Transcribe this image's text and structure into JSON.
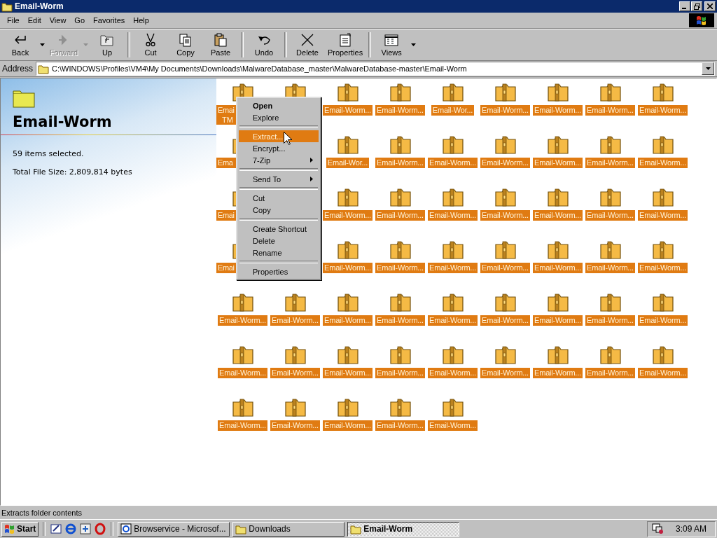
{
  "window": {
    "title": "Email-Worm"
  },
  "menu_bar": [
    "File",
    "Edit",
    "View",
    "Go",
    "Favorites",
    "Help"
  ],
  "toolbar": [
    {
      "label": "Back",
      "kind": "back",
      "disabled": false,
      "dropdown": true
    },
    {
      "label": "Forward",
      "kind": "forward",
      "disabled": true,
      "dropdown": true
    },
    {
      "label": "Up",
      "kind": "up",
      "disabled": false,
      "dropdown": false,
      "group_end": true
    },
    {
      "label": "Cut",
      "kind": "cut",
      "disabled": false,
      "dropdown": false
    },
    {
      "label": "Copy",
      "kind": "copy",
      "disabled": false,
      "dropdown": false
    },
    {
      "label": "Paste",
      "kind": "paste",
      "disabled": false,
      "dropdown": false,
      "group_end": true
    },
    {
      "label": "Undo",
      "kind": "undo",
      "disabled": false,
      "dropdown": false,
      "group_end": true
    },
    {
      "label": "Delete",
      "kind": "delete",
      "disabled": false,
      "dropdown": false
    },
    {
      "label": "Properties",
      "kind": "properties",
      "disabled": false,
      "dropdown": false,
      "group_end": true
    },
    {
      "label": "Views",
      "kind": "views",
      "disabled": false,
      "dropdown": true
    }
  ],
  "address": {
    "label": "Address",
    "value": "C:\\WINDOWS\\Profiles\\VM4\\My Documents\\Downloads\\MalwareDatabase_master\\MalwareDatabase-master\\Email-Worm"
  },
  "info_pane": {
    "title": "Email-Worm",
    "selection": "59 items selected.",
    "size": "Total File Size: 2,809,814 bytes"
  },
  "files": [
    {
      "kind": "partial",
      "label": "Emai",
      "label_2": "TM",
      "selected": true
    },
    {
      "kind": "icon_only",
      "selected": true
    },
    {
      "kind": "file",
      "label": "Email-Worm...",
      "selected": true
    },
    {
      "kind": "file",
      "label": "Email-Worm...",
      "selected": true
    },
    {
      "kind": "file",
      "label": "Email-Wor...",
      "selected": true
    },
    {
      "kind": "file",
      "label": "Email-Worm...",
      "selected": true
    },
    {
      "kind": "file",
      "label": "Email-Worm...",
      "selected": true
    },
    {
      "kind": "file",
      "label": "Email-Worm...",
      "selected": true
    },
    {
      "kind": "file",
      "label": "Email-Worm...",
      "selected": true
    },
    {
      "kind": "partial",
      "label": "Ema",
      "selected": true
    },
    {
      "kind": "covered"
    },
    {
      "kind": "file",
      "label": "Email-Wor...",
      "selected": true
    },
    {
      "kind": "file",
      "label": "Email-Worm...",
      "selected": true
    },
    {
      "kind": "file",
      "label": "Email-Worm...",
      "selected": true
    },
    {
      "kind": "file",
      "label": "Email-Worm...",
      "selected": true
    },
    {
      "kind": "file",
      "label": "Email-Worm...",
      "selected": true
    },
    {
      "kind": "file",
      "label": "Email-Worm...",
      "selected": true
    },
    {
      "kind": "file",
      "label": "Email-Worm...",
      "selected": true
    },
    {
      "kind": "partial",
      "label": "Emai",
      "selected": true
    },
    {
      "kind": "covered"
    },
    {
      "kind": "file",
      "label": "Email-Worm...",
      "selected": true
    },
    {
      "kind": "file",
      "label": "Email-Worm...",
      "selected": true
    },
    {
      "kind": "file",
      "label": "Email-Worm...",
      "selected": true
    },
    {
      "kind": "file",
      "label": "Email-Worm...",
      "selected": true
    },
    {
      "kind": "file",
      "label": "Email-Worm...",
      "selected": true
    },
    {
      "kind": "file",
      "label": "Email-Worm...",
      "selected": true
    },
    {
      "kind": "file",
      "label": "Email-Worm...",
      "selected": true
    },
    {
      "kind": "partial",
      "label": "Emai",
      "selected": true
    },
    {
      "kind": "covered"
    },
    {
      "kind": "file",
      "label": "Email-Worm...",
      "selected": true
    },
    {
      "kind": "file",
      "label": "Email-Worm...",
      "selected": true
    },
    {
      "kind": "file",
      "label": "Email-Worm...",
      "selected": true
    },
    {
      "kind": "file",
      "label": "Email-Worm...",
      "selected": true
    },
    {
      "kind": "file",
      "label": "Email-Worm...",
      "selected": true
    },
    {
      "kind": "file",
      "label": "Email-Worm...",
      "selected": true
    },
    {
      "kind": "file",
      "label": "Email-Worm...",
      "selected": true
    },
    {
      "kind": "file",
      "label": "Email-Worm...",
      "selected": true
    },
    {
      "kind": "file",
      "label": "Email-Worm...",
      "selected": true
    },
    {
      "kind": "file",
      "label": "Email-Worm...",
      "selected": true
    },
    {
      "kind": "file",
      "label": "Email-Worm...",
      "selected": true
    },
    {
      "kind": "file",
      "label": "Email-Worm...",
      "selected": true
    },
    {
      "kind": "file",
      "label": "Email-Worm...",
      "selected": true
    },
    {
      "kind": "file",
      "label": "Email-Worm...",
      "selected": true
    },
    {
      "kind": "file",
      "label": "Email-Worm...",
      "selected": true
    },
    {
      "kind": "file",
      "label": "Email-Worm...",
      "selected": true
    },
    {
      "kind": "file",
      "label": "Email-Worm...",
      "selected": true
    },
    {
      "kind": "file",
      "label": "Email-Worm...",
      "selected": true
    },
    {
      "kind": "file",
      "label": "Email-Worm...",
      "selected": true
    },
    {
      "kind": "file",
      "label": "Email-Worm...",
      "selected": true
    },
    {
      "kind": "file",
      "label": "Email-Worm...",
      "selected": true
    },
    {
      "kind": "file",
      "label": "Email-Worm...",
      "selected": true
    },
    {
      "kind": "file",
      "label": "Email-Worm...",
      "selected": true
    },
    {
      "kind": "file",
      "label": "Email-Worm...",
      "selected": true
    },
    {
      "kind": "file",
      "label": "Email-Worm...",
      "selected": true
    },
    {
      "kind": "file",
      "label": "Email-Worm...",
      "selected": true
    },
    {
      "kind": "file",
      "label": "Email-Worm...",
      "selected": true
    },
    {
      "kind": "file",
      "label": "Email-Worm...",
      "selected": true
    },
    {
      "kind": "file",
      "label": "Email-Worm...",
      "selected": true
    },
    {
      "kind": "file",
      "label": "Email-Worm...",
      "selected": true
    }
  ],
  "context_menu": [
    {
      "kind": "item",
      "label": "Open",
      "default": true,
      "selected": false,
      "submenu": false
    },
    {
      "kind": "item",
      "label": "Explore",
      "default": false,
      "selected": false,
      "submenu": false
    },
    {
      "kind": "separator"
    },
    {
      "kind": "item",
      "label": "Extract...",
      "default": false,
      "selected": true,
      "submenu": false
    },
    {
      "kind": "item",
      "label": "Encrypt...",
      "default": false,
      "selected": false,
      "submenu": false
    },
    {
      "kind": "item",
      "label": "7-Zip",
      "default": false,
      "selected": false,
      "submenu": true
    },
    {
      "kind": "separator"
    },
    {
      "kind": "item",
      "label": "Send To",
      "default": false,
      "selected": false,
      "submenu": true
    },
    {
      "kind": "separator"
    },
    {
      "kind": "item",
      "label": "Cut",
      "default": false,
      "selected": false,
      "submenu": false
    },
    {
      "kind": "item",
      "label": "Copy",
      "default": false,
      "selected": false,
      "submenu": false
    },
    {
      "kind": "separator"
    },
    {
      "kind": "item",
      "label": "Create Shortcut",
      "default": false,
      "selected": false,
      "submenu": false
    },
    {
      "kind": "item",
      "label": "Delete",
      "default": false,
      "selected": false,
      "submenu": false
    },
    {
      "kind": "item",
      "label": "Rename",
      "default": false,
      "selected": false,
      "submenu": false
    },
    {
      "kind": "separator"
    },
    {
      "kind": "item",
      "label": "Properties",
      "default": false,
      "selected": false,
      "submenu": false
    }
  ],
  "status_bar": "Extracts folder contents",
  "taskbar": {
    "start": "Start",
    "tasks": [
      {
        "label": "Browservice - Microsof...",
        "kind": "browser",
        "selected": false
      },
      {
        "label": "Downloads",
        "kind": "folder",
        "selected": false
      },
      {
        "label": "Email-Worm",
        "kind": "folder",
        "selected": true
      }
    ],
    "clock": "3:09 AM"
  }
}
